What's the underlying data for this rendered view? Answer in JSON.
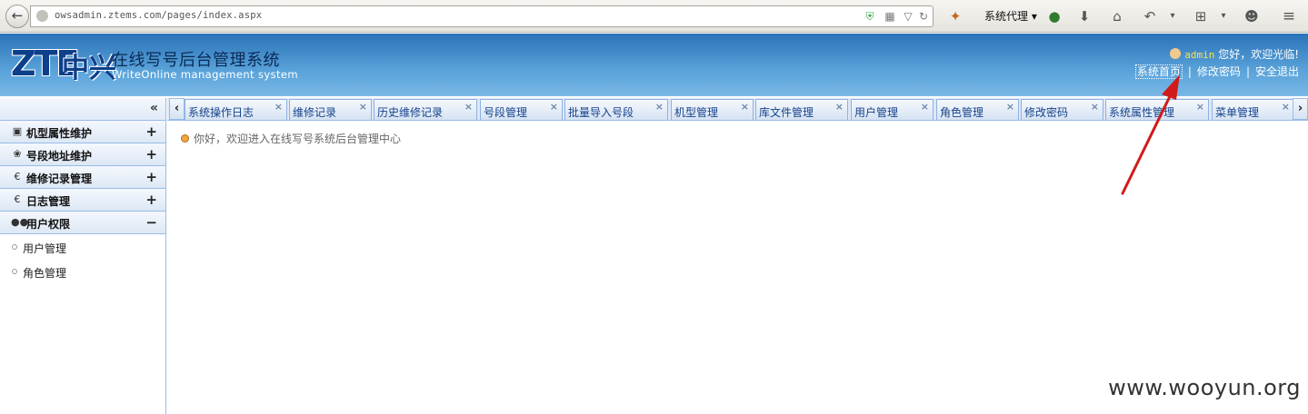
{
  "browser": {
    "url": "owsadmin.ztems.com/pages/index.aspx",
    "proxy_label": "系统代理"
  },
  "header": {
    "logo_latin": "ZTE",
    "logo_cn": "中兴",
    "title": "在线写号后台管理系统",
    "subtitle": "WriteOnline management system",
    "user": "admin",
    "welcome": "您好，欢迎光临!",
    "links": [
      "系统首页",
      "修改密码",
      "安全退出"
    ]
  },
  "sidebar": {
    "collapse_label": "«",
    "sections": [
      {
        "label": "机型属性维护",
        "toggle": "+",
        "icon": "monitor-icon"
      },
      {
        "label": "号段地址维护",
        "toggle": "+",
        "icon": "leaf-icon"
      },
      {
        "label": "维修记录管理",
        "toggle": "+",
        "icon": "euro-icon"
      },
      {
        "label": "日志管理",
        "toggle": "+",
        "icon": "euro-icon"
      },
      {
        "label": "用户权限",
        "toggle": "−",
        "icon": "users-icon"
      }
    ],
    "sub_items": [
      "用户管理",
      "角色管理"
    ]
  },
  "tabs": [
    "系统操作日志",
    "维修记录",
    "历史维修记录",
    "号段管理",
    "批量导入号段",
    "机型管理",
    "库文件管理",
    "用户管理",
    "角色管理",
    "修改密码",
    "系统属性管理",
    "菜单管理"
  ],
  "main": {
    "greeting": "你好，欢迎进入在线写号系统后台管理中心"
  },
  "watermark": "www.wooyun.org",
  "colors": {
    "header_blue": "#2a72b8",
    "annotation_arrow": "#d11a1a",
    "tab_text": "#15428b"
  }
}
